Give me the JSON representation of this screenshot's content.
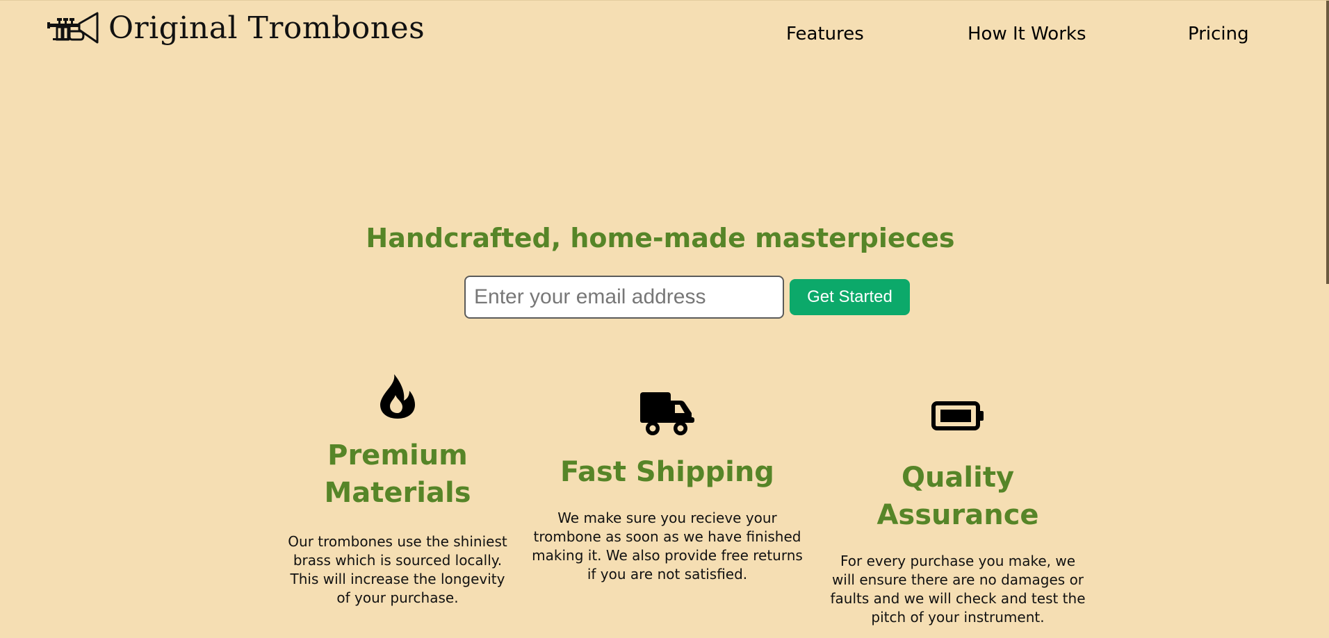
{
  "header": {
    "brand_name": "Original Trombones",
    "logo_icon": "trumpet-icon",
    "nav": [
      {
        "label": "Features"
      },
      {
        "label": "How It Works"
      },
      {
        "label": "Pricing"
      }
    ]
  },
  "hero": {
    "title": "Handcrafted, home-made masterpieces",
    "email_placeholder": "Enter your email address",
    "email_value": "",
    "cta_label": "Get Started"
  },
  "features": [
    {
      "icon": "fire-icon",
      "title": "Premium Materials",
      "text": "Our trombones use the shiniest brass which is sourced locally. This will increase the longevity of your purchase."
    },
    {
      "icon": "truck-icon",
      "title": "Fast Shipping",
      "text": "We make sure you recieve your trombone as soon as we have finished making it. We also provide free returns if you are not satisfied."
    },
    {
      "icon": "battery-full-icon",
      "title": "Quality Assurance",
      "text": "For every purchase you make, we will ensure there are no damages or faults and we will check and test the pitch of your instrument."
    }
  ],
  "colors": {
    "background": "#f5deb3",
    "heading_green": "#568528",
    "button_green": "#0ca96a",
    "text": "#111111"
  }
}
